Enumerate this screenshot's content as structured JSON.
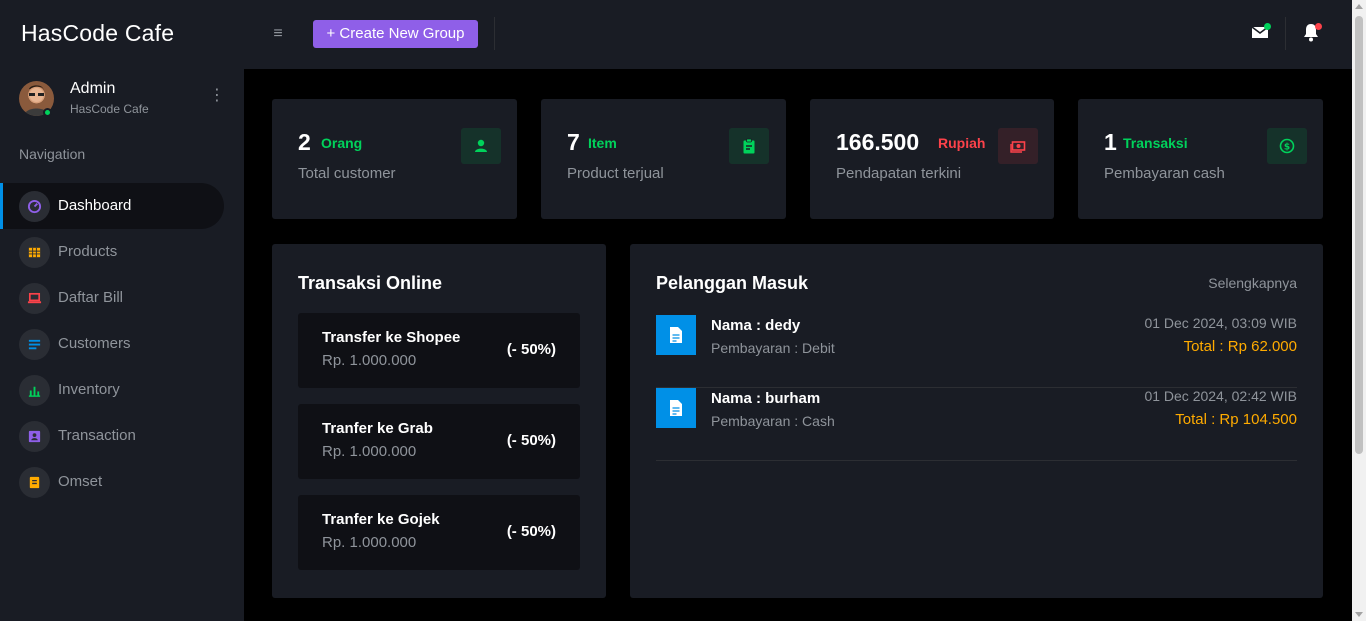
{
  "app": {
    "brand": "HasCode Cafe"
  },
  "header": {
    "create_button": "+ Create New Group",
    "mail_badge_color": "#00d25b",
    "bell_badge_color": "#fc424a"
  },
  "profile": {
    "name": "Admin",
    "subtitle": "HasCode Cafe",
    "status": "online"
  },
  "sidebar": {
    "section_title": "Navigation",
    "items": [
      {
        "label": "Dashboard",
        "icon": "speedometer-icon",
        "active": true
      },
      {
        "label": "Products",
        "icon": "table-icon"
      },
      {
        "label": "Daftar Bill",
        "icon": "laptop-icon"
      },
      {
        "label": "Customers",
        "icon": "list-icon"
      },
      {
        "label": "Inventory",
        "icon": "chart-icon"
      },
      {
        "label": "Transaction",
        "icon": "contacts-icon"
      },
      {
        "label": "Omset",
        "icon": "note-icon"
      }
    ]
  },
  "stats": [
    {
      "value": "2",
      "unit": "Orang",
      "label": "Total customer",
      "icon": "account-icon",
      "color": "#00d25b"
    },
    {
      "value": "7",
      "unit": "Item",
      "label": "Product terjual",
      "icon": "clipboard-icon",
      "color": "#00d25b"
    },
    {
      "value": "166.500",
      "unit": "Rupiah",
      "label": "Pendapatan terkini",
      "icon": "cash-icon",
      "color": "#fc424a"
    },
    {
      "value": "1",
      "unit": "Transaksi",
      "label": "Pembayaran cash",
      "icon": "currency-icon",
      "color": "#00d25b"
    }
  ],
  "online_transactions": {
    "title": "Transaksi Online",
    "items": [
      {
        "title": "Transfer ke Shopee",
        "amount": "Rp. 1.000.000",
        "percent": "(- 50%)"
      },
      {
        "title": "Tranfer ke Grab",
        "amount": "Rp. 1.000.000",
        "percent": "(- 50%)"
      },
      {
        "title": "Tranfer ke Gojek",
        "amount": "Rp. 1.000.000",
        "percent": "(- 50%)"
      }
    ]
  },
  "incoming_customers": {
    "title": "Pelanggan Masuk",
    "see_more": "Selengkapnya",
    "items": [
      {
        "name": "Nama : dedy",
        "payment": "Pembayaran : Debit",
        "date": "01 Dec 2024, 03:09 WIB",
        "total": "Total : Rp 62.000"
      },
      {
        "name": "Nama : burham",
        "payment": "Pembayaran : Cash",
        "date": "01 Dec 2024, 02:42 WIB",
        "total": "Total : Rp 104.500"
      }
    ]
  }
}
